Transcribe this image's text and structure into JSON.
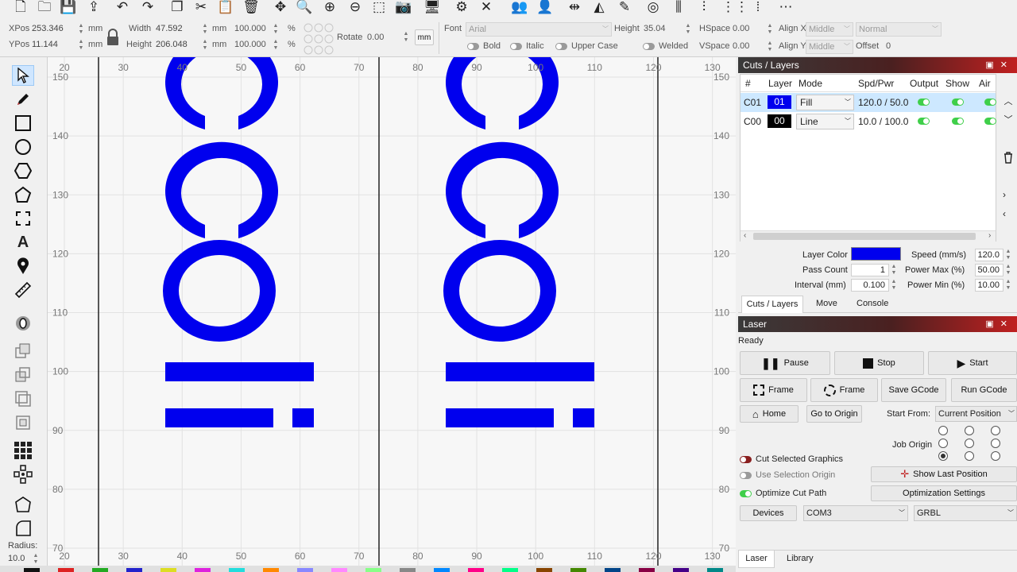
{
  "toolbar": {
    "icons": [
      "new-file-icon",
      "open-folder-icon",
      "save-icon",
      "export-icon",
      "undo-icon",
      "redo-icon",
      "copy-icon",
      "cut-icon",
      "paste-icon",
      "delete-icon",
      "move-icon",
      "zoom-icon",
      "zoom-in-icon",
      "zoom-out-icon",
      "select-frame-icon",
      "camera-icon",
      "monitor-icon",
      "settings-gear-icon",
      "tools-icon",
      "group-icon",
      "user-icon",
      "flip-h-icon",
      "mirror-icon",
      "measure-icon",
      "target-icon",
      "align-icon",
      "align-center-icon",
      "distribute-icon",
      "array-icon",
      "node-edit-icon"
    ]
  },
  "properties": {
    "xpos_label": "XPos",
    "xpos": "253.346",
    "ypos_label": "YPos",
    "ypos": "11.144",
    "unit": "mm",
    "width_label": "Width",
    "width": "47.592",
    "height_label": "Height",
    "height": "206.048",
    "scale_w": "100.000",
    "scale_h": "100.000",
    "percent": "%",
    "rotate_label": "Rotate",
    "rotate": "0.00",
    "mm_button": "mm",
    "font_label": "Font",
    "font": "Arial",
    "font_height_label": "Height",
    "font_height": "35.04",
    "hspace_label": "HSpace",
    "hspace": "0.00",
    "vspace_label": "VSpace",
    "vspace": "0.00",
    "alignx_label": "Align X",
    "alignx": "Middle",
    "aligny_label": "Align Y",
    "aligny": "Middle",
    "normal": "Normal",
    "offset_label": "Offset",
    "offset": "0",
    "bold": "Bold",
    "italic": "Italic",
    "upper_case": "Upper Case",
    "welded": "Welded"
  },
  "left_tools": {
    "icons": [
      "select-arrow-icon",
      "pencil-icon",
      "rectangle-icon",
      "ellipse-icon",
      "polygon-icon",
      "pentagon-icon",
      "corner-frame-icon",
      "text-icon",
      "position-pin-icon",
      "ruler-icon",
      "offset-ring-icon",
      "boolean-union-icon",
      "boolean-subtract-icon",
      "boolean-intersect-icon",
      "weld-icon",
      "grid-array-icon",
      "circular-array-icon",
      "shape-properties-icon",
      "rounded-corner-icon"
    ],
    "radius_label": "Radius:",
    "radius_value": "10.0"
  },
  "ruler": {
    "top_ticks": [
      "20",
      "30",
      "40",
      "50",
      "60",
      "70",
      "80",
      "90",
      "100",
      "110",
      "120",
      "130"
    ],
    "side_ticks": [
      "150",
      "140",
      "130",
      "120",
      "110",
      "100",
      "90",
      "80",
      "70"
    ]
  },
  "cuts_layers": {
    "title": "Cuts / Layers",
    "columns": [
      "#",
      "Layer",
      "Mode",
      "Spd/Pwr",
      "Output",
      "Show",
      "Air"
    ],
    "rows": [
      {
        "id": "C01",
        "layer": "01",
        "color": "#0000ee",
        "mode": "Fill",
        "spdpwr": "120.0 / 50.0",
        "output": true,
        "show": true,
        "air": true
      },
      {
        "id": "C00",
        "layer": "00",
        "color": "#000000",
        "mode": "Line",
        "spdpwr": "10.0 / 100.0",
        "output": true,
        "show": true,
        "air": true
      }
    ],
    "layer_color_label": "Layer Color",
    "layer_color": "#0000ee",
    "speed_label": "Speed (mm/s)",
    "speed": "120.0",
    "pass_count_label": "Pass Count",
    "pass_count": "1",
    "power_max_label": "Power Max (%)",
    "power_max": "50.00",
    "interval_label": "Interval (mm)",
    "interval": "0.100",
    "power_min_label": "Power Min (%)",
    "power_min": "10.00",
    "tabs": [
      "Cuts / Layers",
      "Move",
      "Console"
    ]
  },
  "laser": {
    "title": "Laser",
    "status": "Ready",
    "pause": "Pause",
    "stop": "Stop",
    "start": "Start",
    "frame1": "Frame",
    "frame2": "Frame",
    "save_gcode": "Save GCode",
    "run_gcode": "Run GCode",
    "home": "Home",
    "go_to_origin": "Go to Origin",
    "start_from_label": "Start From:",
    "start_from": "Current Position",
    "job_origin_label": "Job Origin",
    "cut_selected": "Cut Selected Graphics",
    "use_selection_origin": "Use Selection Origin",
    "optimize_cut_path": "Optimize Cut Path",
    "show_last_position": "Show Last Position",
    "optimization_settings": "Optimization Settings",
    "devices": "Devices",
    "port": "COM3",
    "controller": "GRBL",
    "tabs": [
      "Laser",
      "Library"
    ]
  },
  "colors": {
    "shape_fill": "#0000ee",
    "accent_red": "#c02020",
    "toggle_on": "#3fcf4a",
    "selection_row": "#cde8ff"
  }
}
